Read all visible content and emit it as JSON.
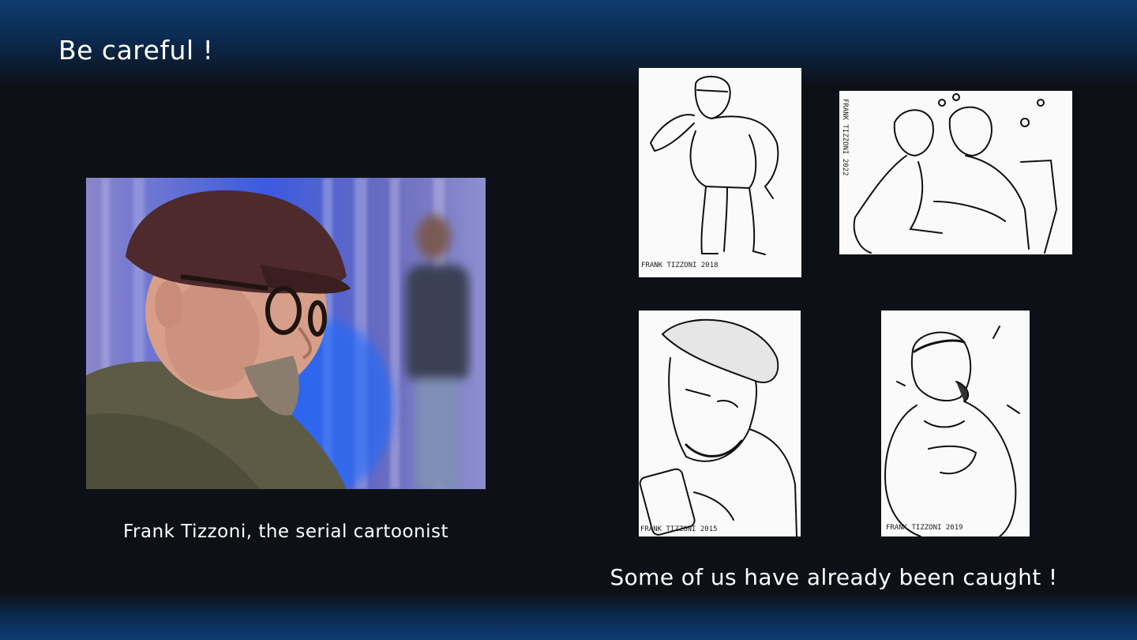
{
  "slide": {
    "title": "Be careful !",
    "photo_caption": "Frank Tizzoni, the serial cartoonist",
    "sketches_caption": "Some of us have already been caught !"
  },
  "sketches": [
    {
      "signature": "FRANK TIZZONI 2018"
    },
    {
      "signature": "FRANK TIZZONI 2022"
    },
    {
      "signature": "FRANK TIZZONI 2015"
    },
    {
      "signature": "FRANK TIZZONI 2019"
    }
  ],
  "colors": {
    "background": "#0d1117",
    "band": "#0e3d70",
    "text": "#ffffff"
  }
}
